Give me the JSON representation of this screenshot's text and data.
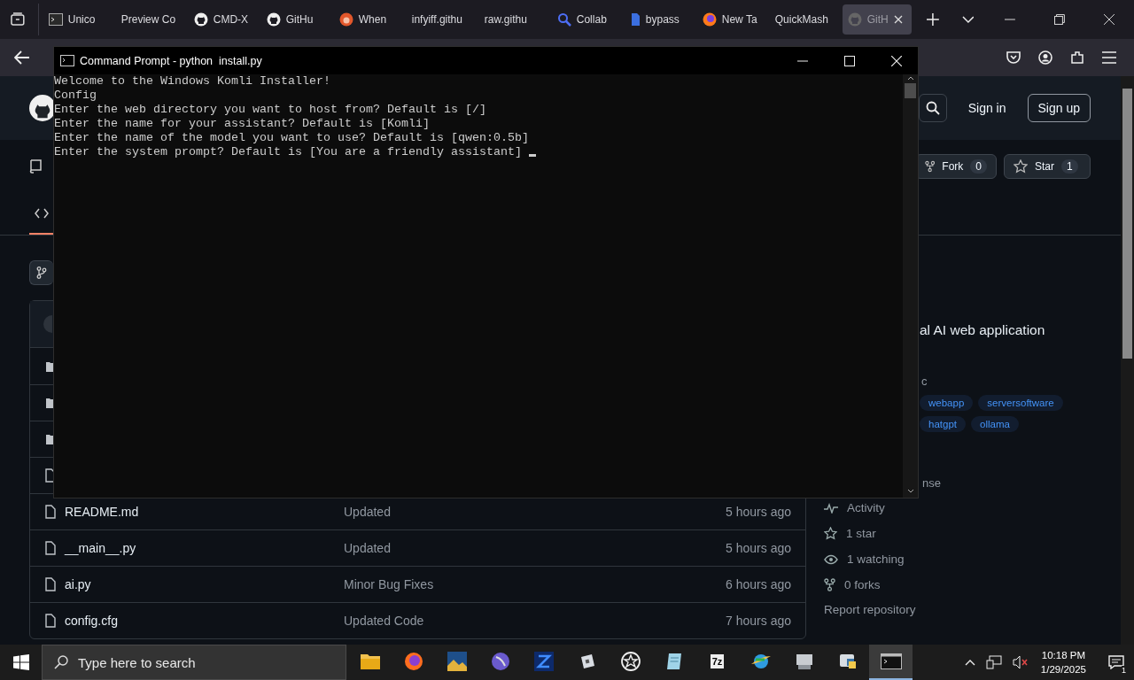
{
  "browser": {
    "tabs": [
      {
        "label": "Unico",
        "kind": "terminal",
        "selected": false
      },
      {
        "label": "Preview Co",
        "kind": "plain",
        "selected": false
      },
      {
        "label": "CMD-X",
        "kind": "github",
        "selected": false
      },
      {
        "label": "GitHu",
        "kind": "github",
        "selected": false
      },
      {
        "label": "When",
        "kind": "lion",
        "selected": false
      },
      {
        "label": "infyiff.githu",
        "kind": "plain",
        "selected": false
      },
      {
        "label": "raw.githu",
        "kind": "plain",
        "selected": false
      },
      {
        "label": "Collab",
        "kind": "search",
        "selected": false
      },
      {
        "label": "bypass",
        "kind": "doc",
        "selected": false
      },
      {
        "label": "New Ta",
        "kind": "firefox",
        "selected": false
      },
      {
        "label": "QuickMash",
        "kind": "plain",
        "selected": false
      },
      {
        "label": "GitH",
        "kind": "github",
        "selected": true
      }
    ]
  },
  "page": {
    "header": {
      "sign_in": "Sign in",
      "sign_up": "Sign up"
    },
    "repo_actions": [
      {
        "kind": "fork",
        "label": "Fork",
        "count": "0"
      },
      {
        "kind": "star",
        "label": "Star",
        "count": "1"
      }
    ],
    "repo_tabs": [
      {
        "kind": "code",
        "selected": true
      }
    ],
    "files": [
      {
        "kind": "folder"
      },
      {
        "kind": "folder"
      },
      {
        "kind": "folder"
      },
      {
        "kind": "file"
      },
      {
        "kind": "file",
        "name": "README.md",
        "message": "Updated",
        "time": "5 hours ago"
      },
      {
        "kind": "file",
        "name": "__main__.py",
        "message": "Updated",
        "time": "5 hours ago"
      },
      {
        "kind": "file",
        "name": "ai.py",
        "message": "Minor Bug Fixes",
        "time": "6 hours ago"
      },
      {
        "kind": "file",
        "name": "config.cfg",
        "message": "Updated Code",
        "time": "7 hours ago"
      }
    ],
    "about": {
      "description": "al AI web application",
      "line_2": "c",
      "topic_rows": [
        [
          {
            "label": "webapp"
          },
          {
            "label": "serversoftware"
          }
        ],
        [
          {
            "label": "hatgpt"
          },
          {
            "label": "ollama"
          }
        ]
      ],
      "line_3": "nse",
      "stats": [
        {
          "kind": "activity",
          "label": "Activity"
        },
        {
          "kind": "star",
          "label": "1 star"
        },
        {
          "kind": "eye",
          "label": "1 watching"
        },
        {
          "kind": "fork",
          "label": "0 forks"
        }
      ],
      "report": "Report repository"
    }
  },
  "console": {
    "title": "Command Prompt - python  install.py",
    "lines": [
      "Welcome to the Windows Komli Installer!",
      "Config",
      "Enter the web directory you want to host from? Default is [/]",
      "Enter the name for your assistant? Default is [Komli]",
      "Enter the name of the model you want to use? Default is [qwen:0.5b]",
      "Enter the system prompt? Default is [You are a friendly assistant] "
    ]
  },
  "taskbar": {
    "search": {
      "placeholder": "Type here to search"
    },
    "apps": [
      {
        "kind": "folder",
        "selected": false
      },
      {
        "kind": "firefox",
        "selected": false
      },
      {
        "kind": "image",
        "selected": false
      },
      {
        "kind": "orb",
        "selected": false
      },
      {
        "kind": "editor",
        "selected": false
      },
      {
        "kind": "cube",
        "selected": false
      },
      {
        "kind": "star",
        "selected": false
      },
      {
        "kind": "notes",
        "selected": false
      },
      {
        "kind": "archive",
        "label": "7z",
        "selected": false
      },
      {
        "kind": "globe",
        "selected": false
      },
      {
        "kind": "monitor",
        "selected": false
      },
      {
        "kind": "python",
        "selected": false
      },
      {
        "kind": "terminal",
        "selected": true
      }
    ],
    "time": "10:18 PM",
    "date": "1/29/2025",
    "notifications": "1"
  }
}
